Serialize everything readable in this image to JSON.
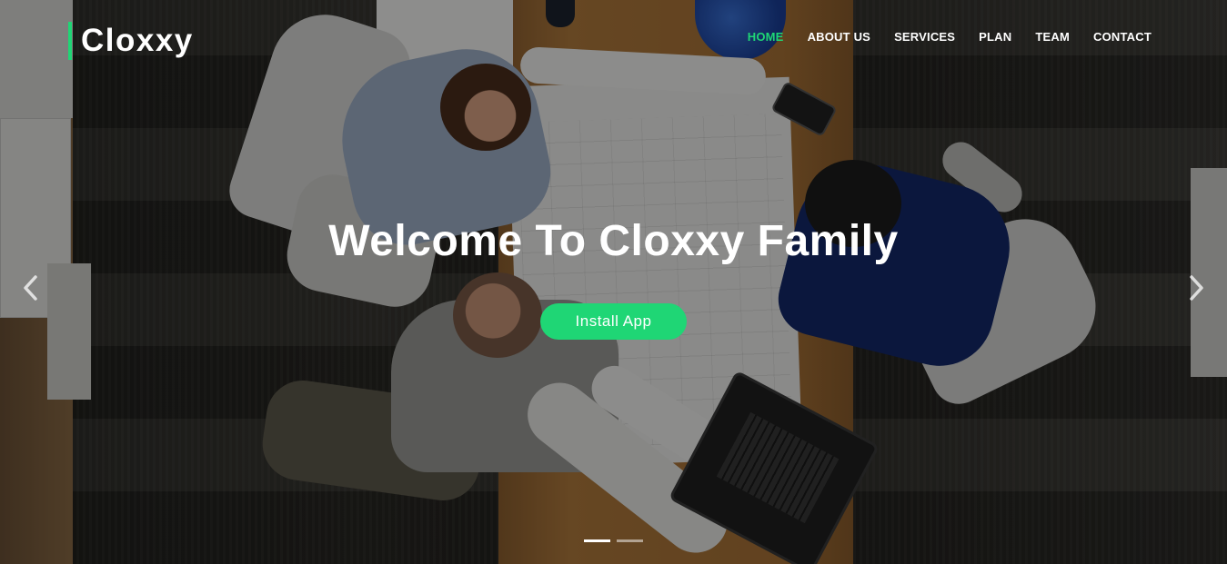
{
  "brand": {
    "name": "Cloxxy",
    "accent": "#1fd675"
  },
  "nav": {
    "items": [
      {
        "label": "HOME",
        "active": true
      },
      {
        "label": "ABOUT US",
        "active": false
      },
      {
        "label": "SERVICES",
        "active": false
      },
      {
        "label": "PLAN",
        "active": false
      },
      {
        "label": "TEAM",
        "active": false
      },
      {
        "label": "CONTACT",
        "active": false
      }
    ]
  },
  "hero": {
    "title": "Welcome To Cloxxy Family",
    "button_label": "Install App",
    "prev_icon": "chevron-left-icon",
    "next_icon": "chevron-right-icon",
    "slides": [
      {
        "active": true
      },
      {
        "active": false
      }
    ]
  }
}
